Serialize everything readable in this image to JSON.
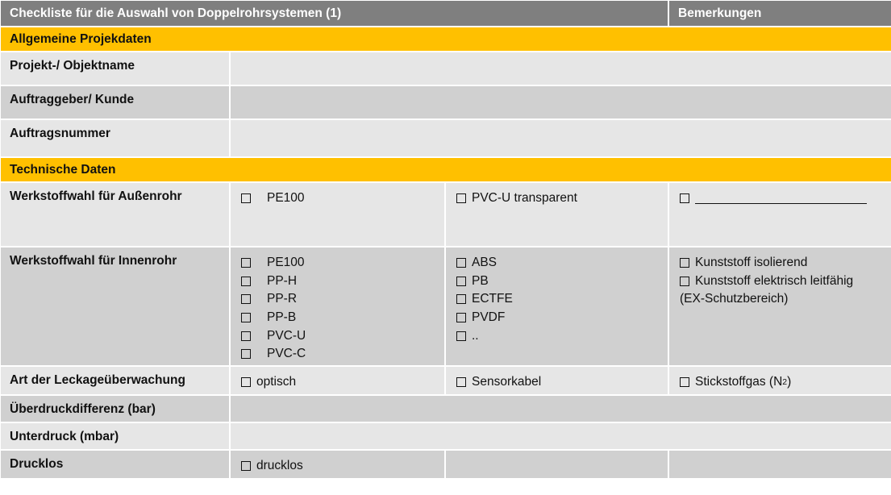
{
  "header": {
    "title": "Checkliste für die Auswahl von Doppelrohrsystemen (1)",
    "remarks": "Bemerkungen"
  },
  "sections": {
    "general": "Allgemeine Projekdaten",
    "technical": "Technische Daten"
  },
  "rows": {
    "project_name": "Projekt-/ Objektname",
    "client": "Auftraggeber/ Kunde",
    "order_number": "Auftragsnummer",
    "outer_material": "Werkstoffwahl für Außenrohr",
    "inner_material": "Werkstoffwahl für Innenrohr",
    "leak_monitoring": "Art der Leckageüberwachung",
    "overpressure": "Überdruckdifferenz (bar)",
    "underpressure": "Unterdruck (mbar)",
    "pressureless": "Drucklos"
  },
  "outer": {
    "col1": [
      "PE100"
    ],
    "col2": [
      "PVC-U transparent"
    ]
  },
  "inner": {
    "col1": [
      "PE100",
      "PP-H",
      "PP-R",
      "PP-B",
      "PVC-U",
      "PVC-C"
    ],
    "col2": [
      "ABS",
      "PB",
      "ECTFE",
      "PVDF",
      ".."
    ],
    "col3_option1": "Kunststoff isolierend",
    "col3_option2_line1": "Kunststoff elektrisch leitfähig",
    "col3_option2_line2": "(EX-Schutzbereich)"
  },
  "leak": {
    "col1": "optisch",
    "col2": "Sensorkabel",
    "col3_prefix": "Stickstoffgas (N",
    "col3_sub": "2",
    "col3_suffix": ")"
  },
  "pressureless": {
    "col1": "drucklos"
  }
}
